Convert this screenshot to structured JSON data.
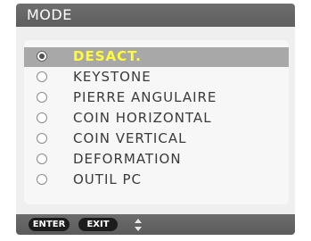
{
  "menu": {
    "title": "MODE",
    "options": [
      {
        "label": "DESACT.",
        "selected": true
      },
      {
        "label": "KEYSTONE",
        "selected": false
      },
      {
        "label": "PIERRE ANGULAIRE",
        "selected": false
      },
      {
        "label": "COIN HORIZONTAL",
        "selected": false
      },
      {
        "label": "COIN VERTICAL",
        "selected": false
      },
      {
        "label": "DEFORMATION",
        "selected": false
      },
      {
        "label": "OUTIL PC",
        "selected": false
      }
    ]
  },
  "footer": {
    "enter_label": "ENTER",
    "exit_label": "EXIT",
    "nav_icon": "up-down-arrows-icon"
  },
  "colors": {
    "header_bg": "#666666",
    "selected_row_bg": "#a8a8a8",
    "selected_text": "#ffff33",
    "option_text": "#3a3a3a",
    "key_bg": "#1c1c1c"
  }
}
